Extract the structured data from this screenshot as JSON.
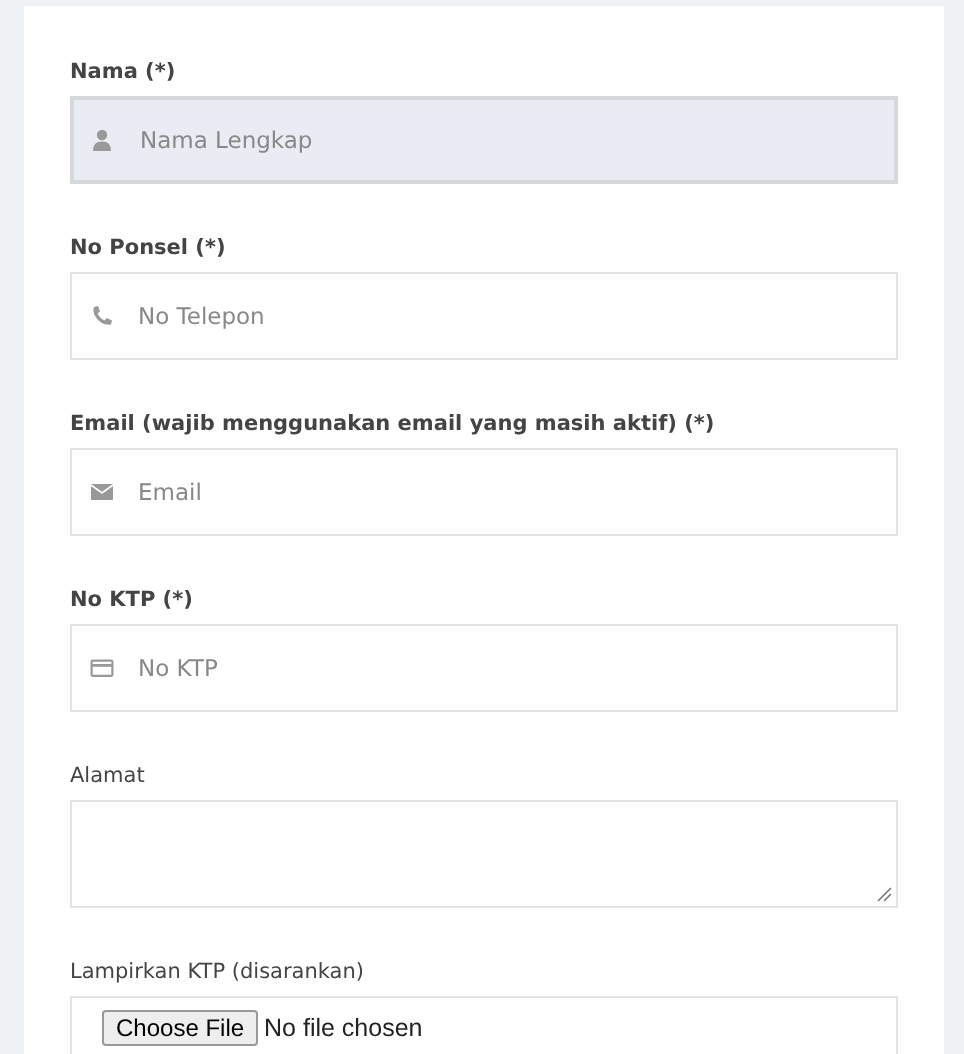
{
  "fields": [
    {
      "kind": "icon",
      "label": "Nama (*)",
      "placeholder": "Nama Lengkap",
      "focused": true
    },
    {
      "kind": "icon",
      "label": "No Ponsel (*)",
      "placeholder": "No Telepon",
      "focused": false
    },
    {
      "kind": "icon",
      "label": "Email (wajib menggunakan email yang masih aktif) (*)",
      "placeholder": "Email",
      "focused": false
    },
    {
      "kind": "icon",
      "label": "No KTP (*)",
      "placeholder": "No KTP",
      "focused": false
    },
    {
      "kind": "textarea",
      "label": "Alamat"
    },
    {
      "kind": "file",
      "label": "Lampirkan KTP (disarankan)",
      "button": "Choose File",
      "status": "No file chosen"
    }
  ]
}
